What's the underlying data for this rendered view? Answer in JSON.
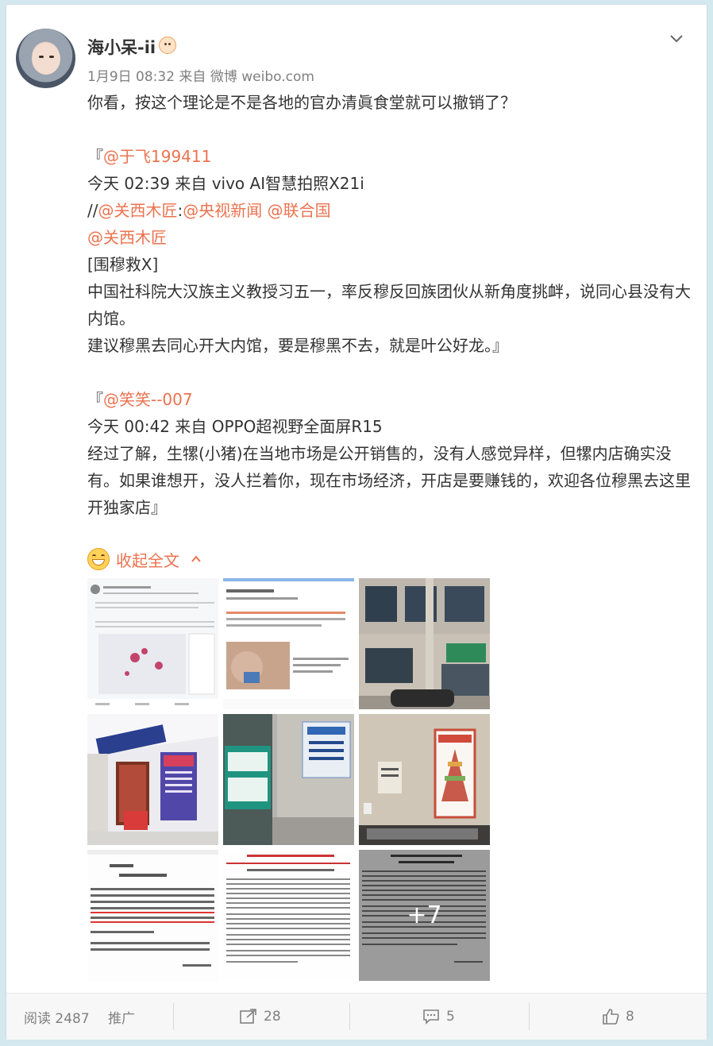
{
  "post": {
    "username": "海小呆-ii",
    "meta": "1月9日 08:32 来自 微博 weibo.com",
    "text": "你看，按这个理论是不是各地的官办清眞食堂就可以撤销了？",
    "quote1": {
      "open": "『",
      "mention": "@于飞199411",
      "time_line": "今天 02:39 来自 vivo AI智慧拍照X21i",
      "chain_prefix": "//",
      "chain_m1": "@关西木匠",
      "chain_colon": ":",
      "chain_m2": "@央视新闻",
      "chain_m3": "@联合国",
      "mention_line": "@关西木匠",
      "tag": "[围穆救X]",
      "p1": "中国社科院大汉族主义教授习五一，率反穆反回族团伙从新角度挑衅，说同心县没有大内馆。",
      "p2": "建议穆黑去同心开大内馆，要是穆黑不去，就是叶公好龙。』"
    },
    "quote2": {
      "open": "『",
      "mention": "@笑笑--007",
      "time_line": "今天 00:42 来自 OPPO超视野全面屏R15",
      "p1": "经过了解，生㹎(小猪)在当地市场是公开销售的，没有人感觉异样，但㹎内店确实没有。如果谁想开，没人拦着你，现在市场经济，开店是要赚钱的，欢迎各位穆黑去这里开独家店』"
    },
    "collapse_label": "收起全文",
    "more_images": "+7"
  },
  "footer": {
    "reads": "阅读 2487",
    "promote": "推广",
    "reposts": "28",
    "comments": "5",
    "likes": "8"
  },
  "colors": {
    "accent": "#eb7350",
    "page_bg": "#d4e8ef"
  },
  "icons": [
    "avatar",
    "badge-icon",
    "chevron-down-icon",
    "grin-emoji-icon",
    "chevron-up-icon",
    "repost-icon",
    "comment-icon",
    "like-icon"
  ]
}
